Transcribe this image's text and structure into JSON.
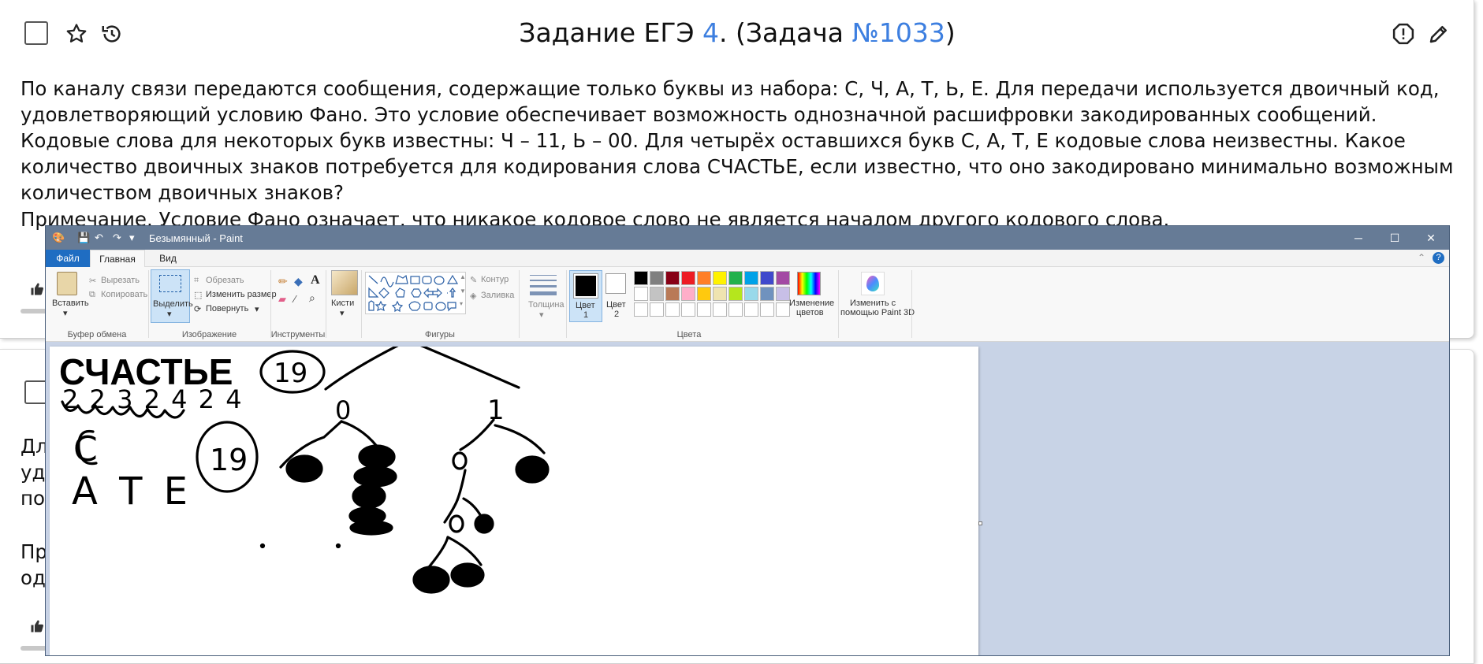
{
  "task": {
    "title_prefix": "Задание ЕГЭ ",
    "exam_task_number": "4",
    "title_middle": ". (Задача ",
    "problem_link": "№1033",
    "title_suffix": ")",
    "paragraph1": "По каналу связи передаются сообщения, содержащие только буквы из набора: С, Ч, А, Т, Ь, Е. Для передачи используется двоичный код, удовлетворяющий условию Фано. Это условие обеспечивает возможность однозначной расшифровки закодированных сообщений. Кодовые слова для некоторых букв известны: Ч – 11, Ь – 00. Для четырёх оставшихся букв С, А, Т, Е кодовые слова неизвестны. Какое количество двоичных знаков потребуется для кодирования слова СЧАСТЬЕ, если известно, что оно закодировано минимально возможным количеством двоичных знаков?",
    "note": "Примечание. Условие Фано означает, что никакое кодовое слово не является началом другого кодового слова."
  },
  "second_task_fragments": [
    "Дл",
    "удо",
    "по",
    "Пр",
    "од"
  ],
  "paint": {
    "window_title": "Безымянный - Paint",
    "tabs": [
      "Файл",
      "Главная",
      "Вид"
    ],
    "clipboard": {
      "paste": "Вставить",
      "cut": "Вырезать",
      "copy": "Копировать",
      "group": "Буфер обмена"
    },
    "image": {
      "select": "Выделить",
      "crop": "Обрезать",
      "resize": "Изменить размер",
      "rotate": "Повернуть",
      "group": "Изображение"
    },
    "tools": {
      "group": "Инструменты"
    },
    "brushes": {
      "label": "Кисти"
    },
    "shapes": {
      "outline": "Контур",
      "fill": "Заливка",
      "group": "Фигуры"
    },
    "size": {
      "label": "Толщина"
    },
    "color1": {
      "label": "Цвет",
      "num": "1"
    },
    "color2": {
      "label": "Цвет",
      "num": "2"
    },
    "colors_group": "Цвета",
    "edit_colors_line1": "Изменение",
    "edit_colors_line2": "цветов",
    "paint3d_line1": "Изменить с",
    "paint3d_line2": "помощью Paint 3D",
    "palette_row1": [
      "#000000",
      "#7f7f7f",
      "#880015",
      "#ed1c24",
      "#ff7f27",
      "#fff200",
      "#22b14c",
      "#00a2e8",
      "#3f48cc",
      "#a349a4"
    ],
    "palette_row2": [
      "#ffffff",
      "#c3c3c3",
      "#b97a57",
      "#ffaec9",
      "#ffc90e",
      "#efe4b0",
      "#b5e61d",
      "#99d9ea",
      "#7092be",
      "#c8bfe7"
    ]
  },
  "drawing": {
    "word": "СЧАСТЬЕ",
    "digits_under_word": "2 2 3 2 4 2 4",
    "total_circled": "19",
    "total_circled_2": "19",
    "letter_c": "С",
    "letters_ate": "А Т Е",
    "branch_0": "0",
    "branch_1": "1",
    "branch_10": "0",
    "branch_100": "0"
  },
  "colors": {
    "accent_link": "#3d7fe0",
    "paint_titlebar": "#667b96",
    "paint_file_tab": "#1f6dc2"
  }
}
